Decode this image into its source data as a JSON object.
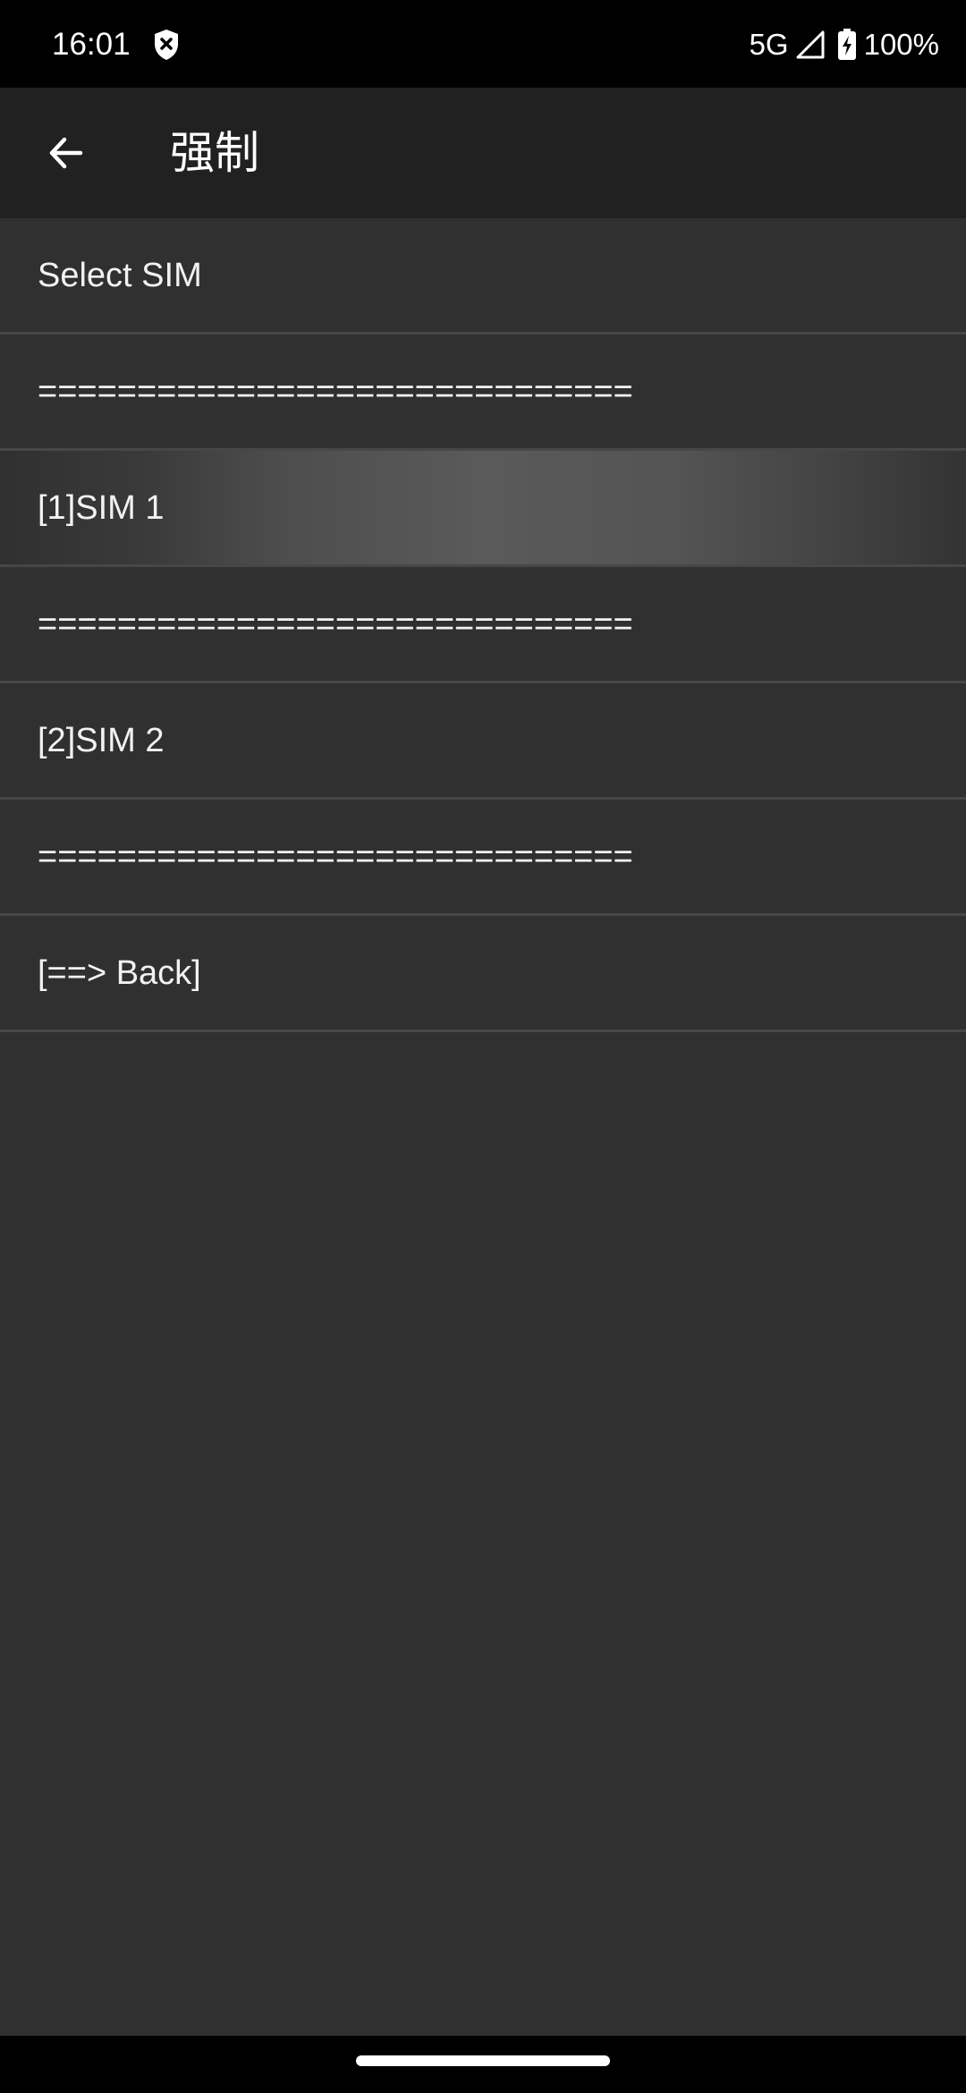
{
  "status_bar": {
    "time": "16:01",
    "network": "5G",
    "battery": "100%",
    "icons": [
      "shield-icon",
      "signal-icon",
      "battery-charging-icon"
    ]
  },
  "app_bar": {
    "back_icon": "arrow-left-icon",
    "title": "强制"
  },
  "menu": {
    "items": [
      {
        "label": "Select SIM",
        "highlighted": false
      },
      {
        "label": "==============================",
        "highlighted": false
      },
      {
        "label": "[1]SIM 1",
        "highlighted": true
      },
      {
        "label": "==============================",
        "highlighted": false
      },
      {
        "label": "[2]SIM 2",
        "highlighted": false
      },
      {
        "label": "==============================",
        "highlighted": false
      },
      {
        "label": "[==> Back]",
        "highlighted": false
      }
    ]
  },
  "colors": {
    "background": "#303030",
    "app_bar": "#212121",
    "status_bar": "#000000",
    "divider": "#474747",
    "text": "#f2f2f2"
  }
}
